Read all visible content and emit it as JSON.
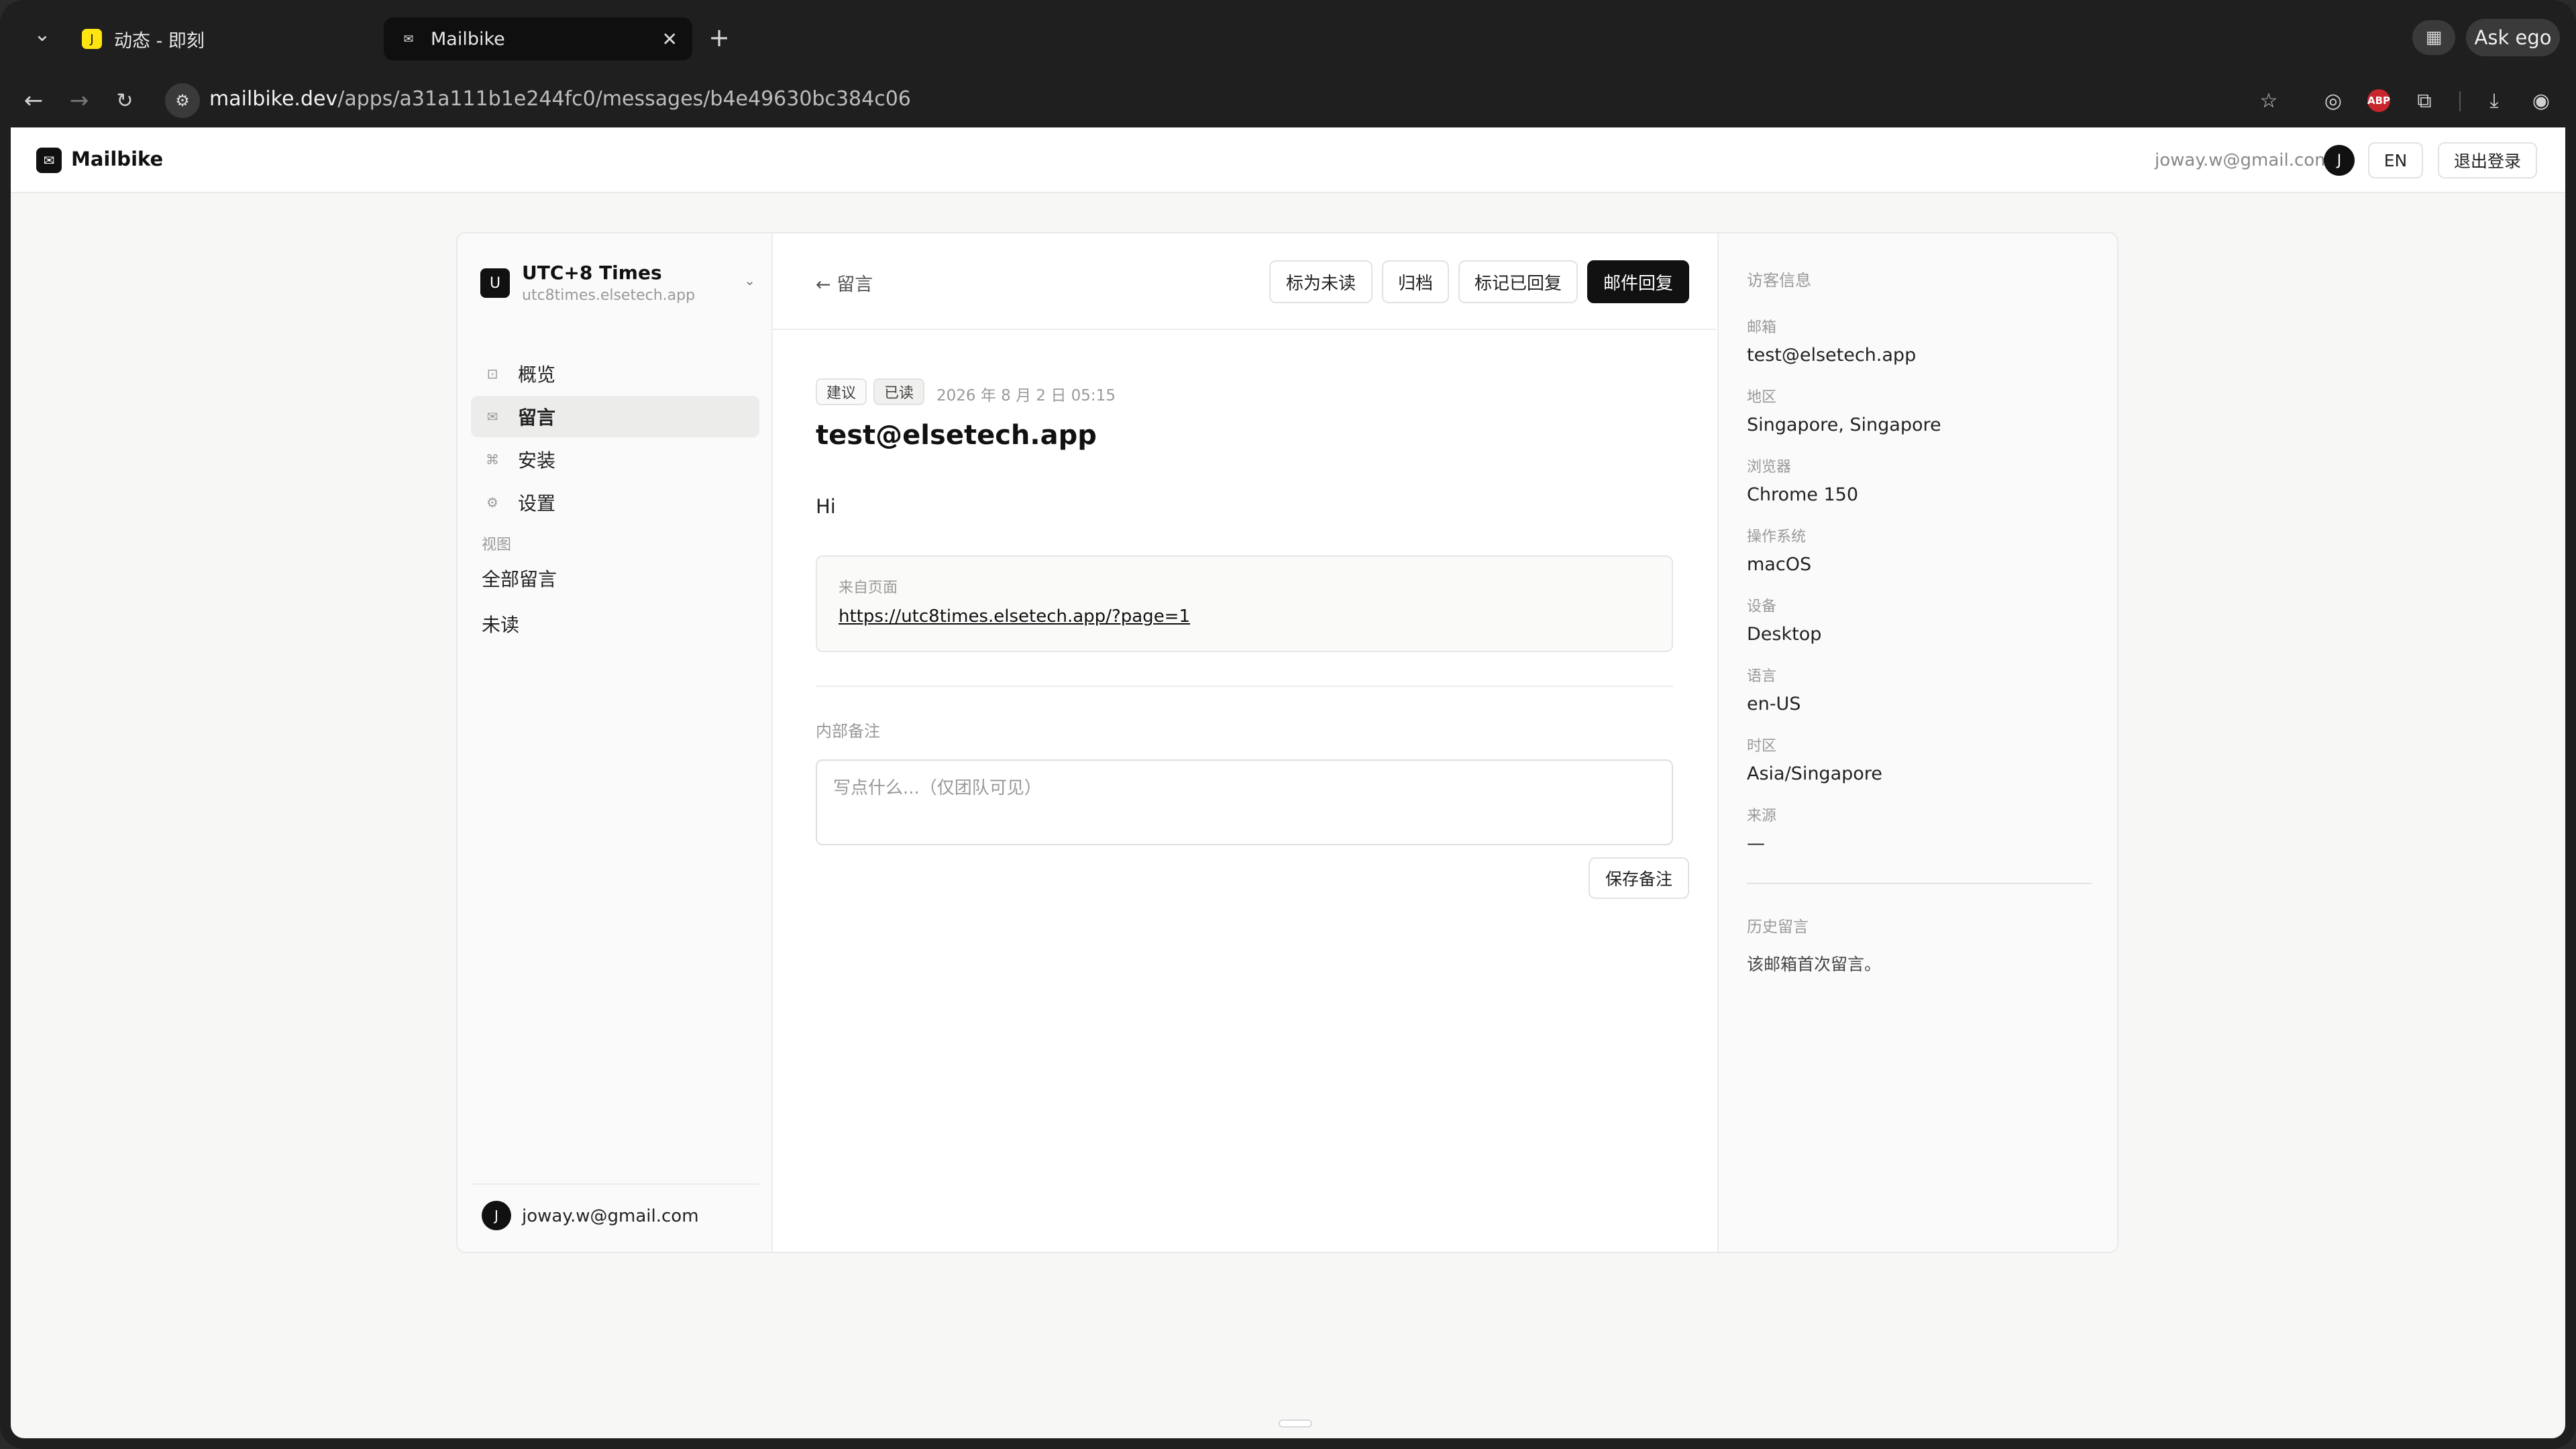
{
  "browser": {
    "tabs": [
      {
        "title": "动态 - 即刻",
        "favicon": "jike-icon",
        "favicon_color": "#FFE411",
        "favicon_char": "J"
      },
      {
        "title": "Mailbike",
        "favicon": "mailbike-icon",
        "favicon_char": "✉"
      }
    ],
    "ask_label": "Ask ego",
    "url_host": "mailbike.dev",
    "url_path": "/apps/a31a111b1e244fc0/messages/b4e49630bc384c06",
    "abp_label": "ABP"
  },
  "header": {
    "logo_text": "Mailbike",
    "email": "joway.w@gmail.com",
    "avatar_initial": "J",
    "lang_label": "EN",
    "logout_label": "退出登录"
  },
  "sidebar": {
    "app_initial": "U",
    "app_name": "UTC+8 Times",
    "app_domain": "utc8times.elsetech.app",
    "nav": [
      {
        "label": "概览",
        "icon": "overview-icon",
        "active": false
      },
      {
        "label": "留言",
        "icon": "messages-icon",
        "active": true
      },
      {
        "label": "安装",
        "icon": "install-icon",
        "active": false
      },
      {
        "label": "设置",
        "icon": "settings-icon",
        "active": false
      }
    ],
    "views_heading": "视图",
    "views": [
      "全部留言",
      "未读"
    ],
    "footer_initial": "J",
    "footer_email": "joway.w@gmail.com"
  },
  "message": {
    "back_label": "← 留言",
    "actions": {
      "mark_unread": "标为未读",
      "archive": "归档",
      "mark_replied": "标记已回复",
      "email_reply": "邮件回复"
    },
    "tag_type": "建议",
    "tag_status": "已读",
    "date": "2026 年 8 月 2 日 05:15",
    "sender": "test@elsetech.app",
    "body": "Hi",
    "source_label": "来自页面",
    "source_url": "https://utc8times.elsetech.app/?page=1",
    "notes_label": "内部备注",
    "notes_placeholder": "写点什么...（仅团队可见）",
    "notes_value": "",
    "save_note_label": "保存备注"
  },
  "visitor": {
    "heading": "访客信息",
    "fields": [
      {
        "key": "邮箱",
        "value": "test@elsetech.app"
      },
      {
        "key": "地区",
        "value": "Singapore, Singapore"
      },
      {
        "key": "浏览器",
        "value": "Chrome 150"
      },
      {
        "key": "操作系统",
        "value": "macOS"
      },
      {
        "key": "设备",
        "value": "Desktop"
      },
      {
        "key": "语言",
        "value": "en-US"
      },
      {
        "key": "时区",
        "value": "Asia/Singapore"
      },
      {
        "key": "来源",
        "value": "—"
      }
    ],
    "history_heading": "历史留言",
    "history_text": "该邮箱首次留言。"
  },
  "colors": {
    "primary_button": "#111111",
    "page_background": "#f7f7f6",
    "active_nav": "#ececeb"
  }
}
